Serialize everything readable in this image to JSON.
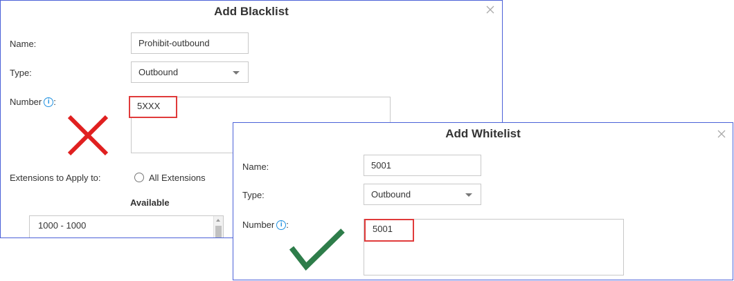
{
  "colors": {
    "dialog_border": "#4a60d8",
    "highlight_border": "#e03a3a",
    "cross_mark": "#e02020",
    "check_mark": "#2e7d4a",
    "info_icon": "#1e90e0"
  },
  "blacklist": {
    "title": "Add Blacklist",
    "close_icon": "close-icon",
    "name_label": "Name:",
    "name_value": "Prohibit-outbound",
    "type_label": "Type:",
    "type_value": "Outbound",
    "number_label": "Number",
    "number_colon": ":",
    "number_value": "5XXX",
    "info_glyph": "i",
    "mark_icon": "cross-icon",
    "extensions_label": "Extensions to Apply to:",
    "all_extensions_label": "All Extensions",
    "available_heading": "Available",
    "available_items": [
      "1000 - 1000"
    ]
  },
  "whitelist": {
    "title": "Add Whitelist",
    "close_icon": "close-icon",
    "name_label": "Name:",
    "name_value": "5001",
    "type_label": "Type:",
    "type_value": "Outbound",
    "number_label": "Number",
    "number_colon": ":",
    "number_value": "5001",
    "info_glyph": "i",
    "mark_icon": "checkmark-icon"
  }
}
